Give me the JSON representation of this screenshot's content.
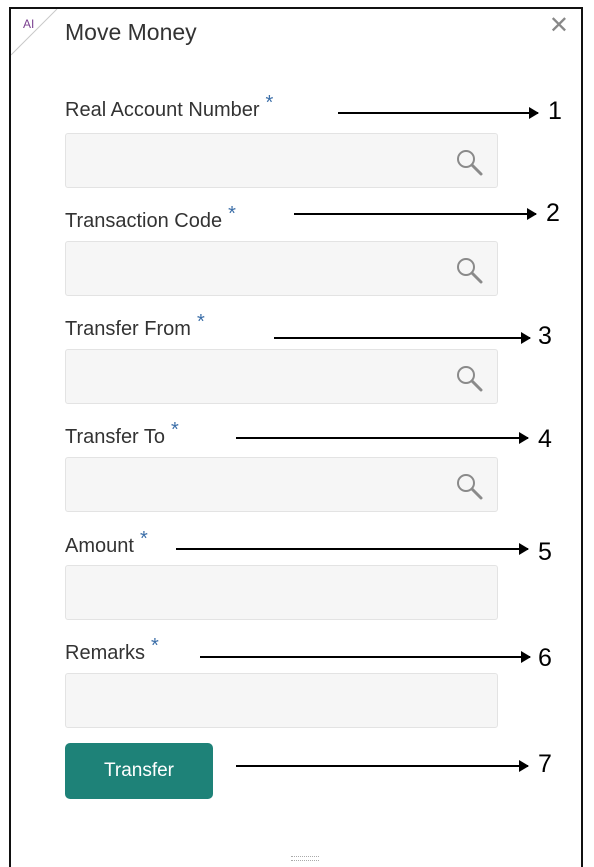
{
  "corner_badge": "AI",
  "title": "Move Money",
  "close_label": "✕",
  "fields": [
    {
      "label": "Real Account Number",
      "required": "*",
      "value": "",
      "callout": "1"
    },
    {
      "label": "Transaction Code",
      "required": "*",
      "value": "",
      "callout": "2"
    },
    {
      "label": "Transfer From",
      "required": "*",
      "value": "",
      "callout": "3"
    },
    {
      "label": "Transfer To",
      "required": "*",
      "value": "",
      "callout": "4"
    },
    {
      "label": "Amount",
      "required": "*",
      "value": "",
      "callout": "5"
    },
    {
      "label": "Remarks",
      "required": "*",
      "value": "",
      "callout": "6"
    }
  ],
  "transfer_button": {
    "label": "Transfer",
    "callout": "7"
  },
  "colors": {
    "accent": "#1e8278",
    "required": "#3b6ea8"
  }
}
